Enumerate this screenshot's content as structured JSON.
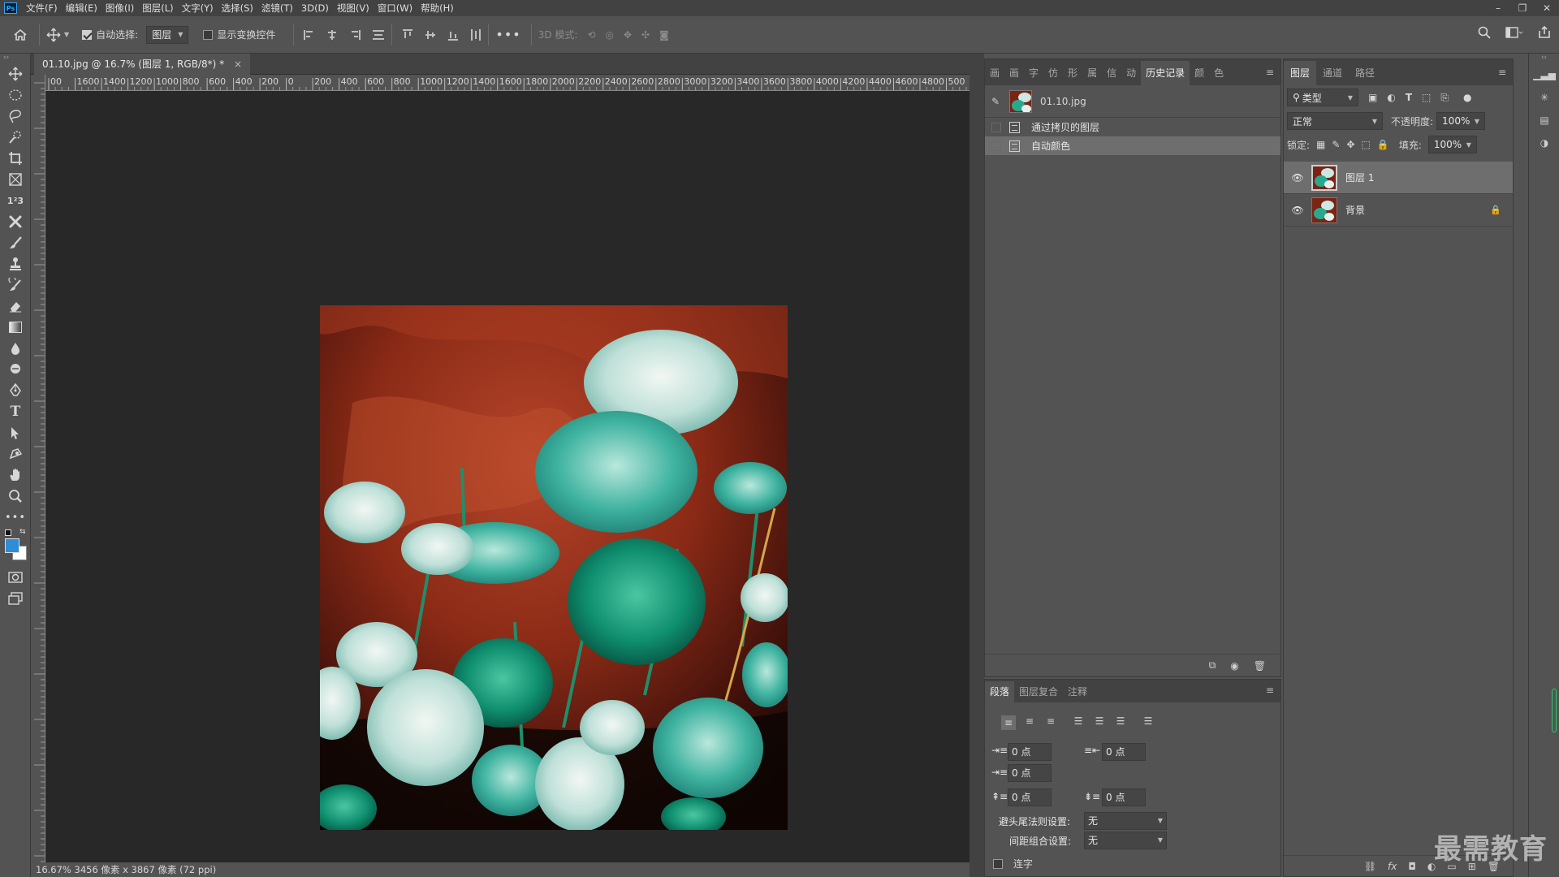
{
  "menu": {
    "logo": "Ps",
    "items": [
      "文件(F)",
      "编辑(E)",
      "图像(I)",
      "图层(L)",
      "文字(Y)",
      "选择(S)",
      "滤镜(T)",
      "3D(D)",
      "视图(V)",
      "窗口(W)",
      "帮助(H)"
    ]
  },
  "window_controls": {
    "minimize": "–",
    "restore": "❐",
    "close": "✕"
  },
  "options": {
    "auto_select_label": "自动选择:",
    "auto_select_target": "图层",
    "show_transform_label": "显示变换控件",
    "mode_3d_label": "3D 模式:"
  },
  "document": {
    "tab_title": "01.10.jpg @ 16.7% (图层 1, RGB/8*) *",
    "tab_close": "×",
    "status": "16.67%  3456 像素 x 3867 像素 (72 ppi)"
  },
  "ruler": {
    "h_labels": [
      "00",
      "1600",
      "1400",
      "1200",
      "1000",
      "800",
      "600",
      "400",
      "200",
      "0",
      "200",
      "400",
      "600",
      "800",
      "1000",
      "1200",
      "1400",
      "1600",
      "1800",
      "2000",
      "2200",
      "2400",
      "2600",
      "2800",
      "3000",
      "3200",
      "3400",
      "3600",
      "3800",
      "4000",
      "4200",
      "4400",
      "4600",
      "4800",
      "500"
    ]
  },
  "history_panel": {
    "tabs": [
      "画",
      "画",
      "字",
      "仿",
      "形",
      "属",
      "信",
      "动",
      "历史记录",
      "颜",
      "色"
    ],
    "active_tab": "历史记录",
    "snapshot": "01.10.jpg",
    "states": [
      {
        "label": "通过拷贝的图层",
        "selected": false
      },
      {
        "label": "自动颜色",
        "selected": true
      }
    ]
  },
  "paragraph_panel": {
    "tabs": [
      "段落",
      "图层复合",
      "注释"
    ],
    "active_tab": "段落",
    "indent_left": "0 点",
    "indent_right": "0 点",
    "indent_first": "0 点",
    "space_before": "0 点",
    "space_after": "0 点",
    "kinsoku_label": "避头尾法则设置:",
    "kinsoku_value": "无",
    "mojikumi_label": "间距组合设置:",
    "mojikumi_value": "无",
    "hyphenate_label": "连字"
  },
  "layers_panel": {
    "tabs": [
      "图层",
      "通道",
      "路径"
    ],
    "active_tab": "图层",
    "filter_kind": "类型",
    "blend_mode": "正常",
    "opacity_label": "不透明度:",
    "opacity_value": "100%",
    "lock_label": "锁定:",
    "fill_label": "填充:",
    "fill_value": "100%",
    "layers": [
      {
        "name": "图层 1",
        "selected": true,
        "locked": false
      },
      {
        "name": "背景",
        "selected": false,
        "locked": true
      }
    ]
  },
  "watermark": "最需教育",
  "colors": {
    "accent": "#31a8ff",
    "foreground": "#2f8cd6",
    "background": "#ffffff"
  }
}
